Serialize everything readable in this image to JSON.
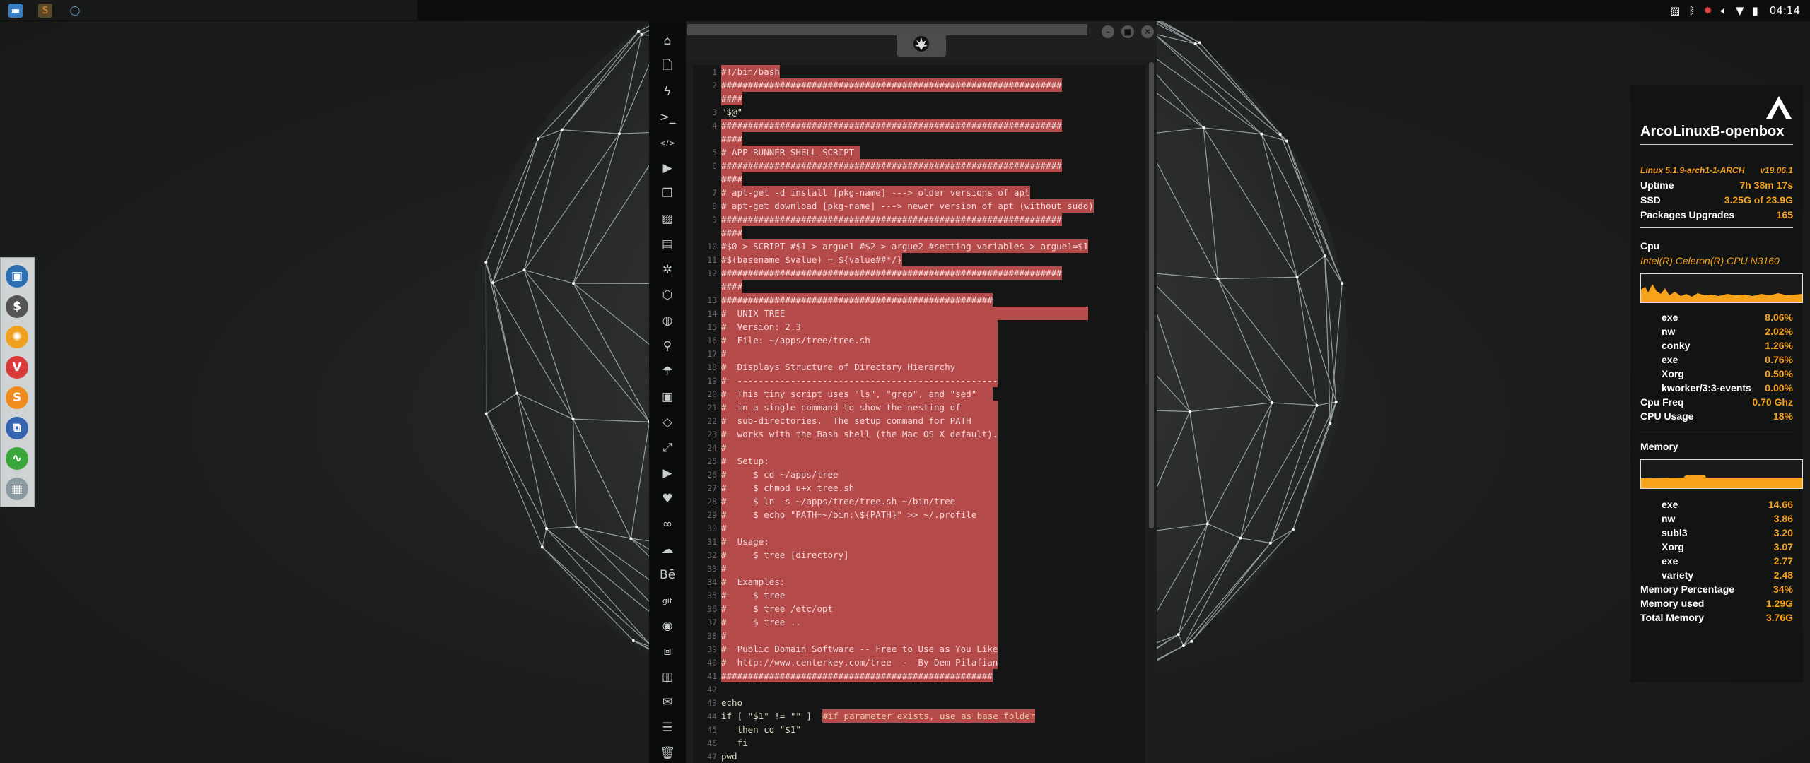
{
  "top_panel": {
    "clock": "04:14",
    "tray_icons": [
      "image-icon",
      "bluetooth-icon",
      "redshift-icon",
      "volume-icon",
      "wifi-icon",
      "battery-icon"
    ]
  },
  "taskbar": {
    "apps": [
      "file-manager-icon",
      "sublime-text-icon",
      "circle-icon"
    ]
  },
  "launcher": {
    "items": [
      {
        "icon": "app-window-icon",
        "glyph": "▣",
        "color": "#2d6fb3"
      },
      {
        "icon": "terminal-dollar-icon",
        "glyph": "$",
        "color": "#555555"
      },
      {
        "icon": "settings-gear-icon",
        "glyph": "✺",
        "color": "#f0a01f"
      },
      {
        "icon": "vivaldi-icon",
        "glyph": "V",
        "color": "#d83a3a"
      },
      {
        "icon": "sublime-s-icon",
        "glyph": "S",
        "color": "#f08c1e"
      },
      {
        "icon": "screenshot-icon",
        "glyph": "⧉",
        "color": "#3564b0"
      },
      {
        "icon": "system-monitor-icon",
        "glyph": "∿",
        "color": "#3aa53a"
      },
      {
        "icon": "grid-icon",
        "glyph": "▦",
        "color": "#8a9aa0"
      }
    ]
  },
  "icon_sidebar": {
    "items": [
      {
        "name": "home-icon",
        "glyph": "⌂"
      },
      {
        "name": "file-icon",
        "glyph": "🗋"
      },
      {
        "name": "bolt-icon",
        "glyph": "ϟ"
      },
      {
        "name": "terminal-icon",
        "glyph": ">_"
      },
      {
        "name": "code-icon",
        "glyph": "</>"
      },
      {
        "name": "play-icon",
        "glyph": "▶"
      },
      {
        "name": "copy-icon",
        "glyph": "❐"
      },
      {
        "name": "image-icon",
        "glyph": "▨"
      },
      {
        "name": "news-icon",
        "glyph": "▤"
      },
      {
        "name": "gear-icon",
        "glyph": "✲"
      },
      {
        "name": "hexagon-icon",
        "glyph": "⬡"
      },
      {
        "name": "globe-icon",
        "glyph": "◍"
      },
      {
        "name": "search-icon",
        "glyph": "⚲"
      },
      {
        "name": "umbrella-icon",
        "glyph": "☂"
      },
      {
        "name": "contact-card-icon",
        "glyph": "▣"
      },
      {
        "name": "diamond-code-icon",
        "glyph": "◇"
      },
      {
        "name": "expand-icon",
        "glyph": "⤢"
      },
      {
        "name": "youtube-icon",
        "glyph": "▶"
      },
      {
        "name": "heart-icon",
        "glyph": "♥"
      },
      {
        "name": "infinity-icon",
        "glyph": "∞"
      },
      {
        "name": "cloud-icon",
        "glyph": "☁"
      },
      {
        "name": "behance-icon",
        "glyph": "Bē"
      },
      {
        "name": "git-icon",
        "glyph": "git"
      },
      {
        "name": "github-icon",
        "glyph": "◉"
      },
      {
        "name": "cubes-icon",
        "glyph": "⧈"
      },
      {
        "name": "map-icon",
        "glyph": "▥"
      },
      {
        "name": "mail-icon",
        "glyph": "✉"
      },
      {
        "name": "server-icon",
        "glyph": "☰"
      },
      {
        "name": "trash-icon",
        "glyph": "🗑"
      }
    ]
  },
  "editor": {
    "logo_icon": "rebel-alliance-icon",
    "lines": [
      {
        "n": "1",
        "t": "#!/bin/bash",
        "style": "sel"
      },
      {
        "n": "2",
        "t": "################################################################",
        "style": "sel"
      },
      {
        "n": "",
        "t": "####",
        "style": "sel"
      },
      {
        "n": "3",
        "t": "\"$@\"",
        "style": "plain"
      },
      {
        "n": "4",
        "t": "################################################################",
        "style": "sel"
      },
      {
        "n": "",
        "t": "####",
        "style": "sel"
      },
      {
        "n": "5",
        "t": "# APP RUNNER SHELL SCRIPT ",
        "style": "sel"
      },
      {
        "n": "6",
        "t": "################################################################",
        "style": "sel"
      },
      {
        "n": "",
        "t": "####",
        "style": "sel"
      },
      {
        "n": "7",
        "t": "# apt-get -d install [pkg-name] ---> older versions of apt",
        "style": "sel"
      },
      {
        "n": "8",
        "t": "# apt-get download [pkg-name] ---> newer version of apt (without sudo)",
        "style": "sel"
      },
      {
        "n": "9",
        "t": "################################################################",
        "style": "sel"
      },
      {
        "n": "",
        "t": "####",
        "style": "sel"
      },
      {
        "n": "10",
        "t": "#$0 > SCRIPT #$1 > argue1 #$2 > argue2 #setting variables > argue1=$1",
        "style": "sel"
      },
      {
        "n": "11",
        "t": "#$(basename $value) = ${value##*/}",
        "style": "sel"
      },
      {
        "n": "12",
        "t": "################################################################",
        "style": "sel"
      },
      {
        "n": "",
        "t": "####",
        "style": "sel"
      },
      {
        "n": "13",
        "t": "###################################################",
        "style": "sel"
      },
      {
        "n": "14",
        "t": "#  UNIX TREE                                                         ",
        "style": "sel"
      },
      {
        "n": "15",
        "t": "#  Version: 2.3                                     ",
        "style": "sel"
      },
      {
        "n": "16",
        "t": "#  File: ~/apps/tree/tree.sh                        ",
        "style": "sel"
      },
      {
        "n": "17",
        "t": "#                                                   ",
        "style": "sel"
      },
      {
        "n": "18",
        "t": "#  Displays Structure of Directory Hierarchy        ",
        "style": "sel"
      },
      {
        "n": "19",
        "t": "#  -------------------------------------------------",
        "style": "sel"
      },
      {
        "n": "20",
        "t": "#  This tiny script uses \"ls\", \"grep\", and \"sed\"   ",
        "style": "sel"
      },
      {
        "n": "21",
        "t": "#  in a single command to show the nesting of       ",
        "style": "sel"
      },
      {
        "n": "22",
        "t": "#  sub-directories.  The setup command for PATH     ",
        "style": "sel"
      },
      {
        "n": "23",
        "t": "#  works with the Bash shell (the Mac OS X default).",
        "style": "sel"
      },
      {
        "n": "24",
        "t": "#                                                   ",
        "style": "sel"
      },
      {
        "n": "25",
        "t": "#  Setup:                                           ",
        "style": "sel"
      },
      {
        "n": "26",
        "t": "#     $ cd ~/apps/tree                              ",
        "style": "sel"
      },
      {
        "n": "27",
        "t": "#     $ chmod u+x tree.sh                           ",
        "style": "sel"
      },
      {
        "n": "28",
        "t": "#     $ ln -s ~/apps/tree/tree.sh ~/bin/tree        ",
        "style": "sel"
      },
      {
        "n": "29",
        "t": "#     $ echo \"PATH=~/bin:\\${PATH}\" >> ~/.profile    ",
        "style": "sel"
      },
      {
        "n": "30",
        "t": "#                                                   ",
        "style": "sel"
      },
      {
        "n": "31",
        "t": "#  Usage:                                           ",
        "style": "sel"
      },
      {
        "n": "32",
        "t": "#     $ tree [directory]                            ",
        "style": "sel"
      },
      {
        "n": "33",
        "t": "#                                                   ",
        "style": "sel"
      },
      {
        "n": "34",
        "t": "#  Examples:                                        ",
        "style": "sel"
      },
      {
        "n": "35",
        "t": "#     $ tree                                        ",
        "style": "sel"
      },
      {
        "n": "36",
        "t": "#     $ tree /etc/opt                               ",
        "style": "sel"
      },
      {
        "n": "37",
        "t": "#     $ tree ..                                     ",
        "style": "sel"
      },
      {
        "n": "38",
        "t": "#                                                   ",
        "style": "sel"
      },
      {
        "n": "39",
        "t": "#  Public Domain Software -- Free to Use as You Like",
        "style": "sel"
      },
      {
        "n": "40",
        "t": "#  http://www.centerkey.com/tree  -  By Dem Pilafian",
        "style": "sel"
      },
      {
        "n": "41",
        "t": "###################################################",
        "style": "sel"
      },
      {
        "n": "42",
        "t": "",
        "style": "plain"
      },
      {
        "n": "43",
        "t": "echo",
        "style": "plain"
      },
      {
        "n": "44",
        "t": "if [ \"$1\" != \"\" ]  ",
        "style": "plain",
        "comment": "#if parameter exists, use as base folder"
      },
      {
        "n": "45",
        "t": "   then cd \"$1\"",
        "style": "plain"
      },
      {
        "n": "46",
        "t": "   fi",
        "style": "plain"
      },
      {
        "n": "47",
        "t": "pwd",
        "style": "plain"
      }
    ]
  },
  "conky": {
    "logo_icon": "arcolinux-logo-icon",
    "hostname": "ArcoLinuxB-openbox",
    "kernel": "Linux 5.1.9-arch1-1-ARCH",
    "version": "v19.06.1",
    "uptime_label": "Uptime",
    "uptime": "7h 38m 17s",
    "ssd_label": "SSD",
    "ssd": "3.25G of 23.9G",
    "pkg_label": "Packages Upgrades",
    "pkg": "165",
    "cpu_header": "Cpu",
    "cpu_model": "Intel(R) Celeron(R) CPU  N3160",
    "cpu_procs": [
      {
        "name": "exe",
        "val": "8.06%"
      },
      {
        "name": "nw",
        "val": "2.02%"
      },
      {
        "name": "conky",
        "val": "1.26%"
      },
      {
        "name": "exe",
        "val": "0.76%"
      },
      {
        "name": "Xorg",
        "val": "0.50%"
      },
      {
        "name": "kworker/3:3-events",
        "val": "0.00%"
      }
    ],
    "cpu_freq_label": "Cpu Freq",
    "cpu_freq": "0.70 Ghz",
    "cpu_usage_label": "CPU Usage",
    "cpu_usage": "18%",
    "mem_header": "Memory",
    "mem_procs": [
      {
        "name": "exe",
        "val": "14.66"
      },
      {
        "name": "nw",
        "val": "3.86"
      },
      {
        "name": "subl3",
        "val": "3.20"
      },
      {
        "name": "Xorg",
        "val": "3.07"
      },
      {
        "name": "exe",
        "val": "2.77"
      },
      {
        "name": "variety",
        "val": "2.48"
      }
    ],
    "mem_pct_label": "Memory Percentage",
    "mem_pct": "34%",
    "mem_used_label": "Memory used",
    "mem_used": "1.29G",
    "mem_total_label": "Total Memory",
    "mem_total": "3.76G",
    "accent": "#f7a21b"
  }
}
